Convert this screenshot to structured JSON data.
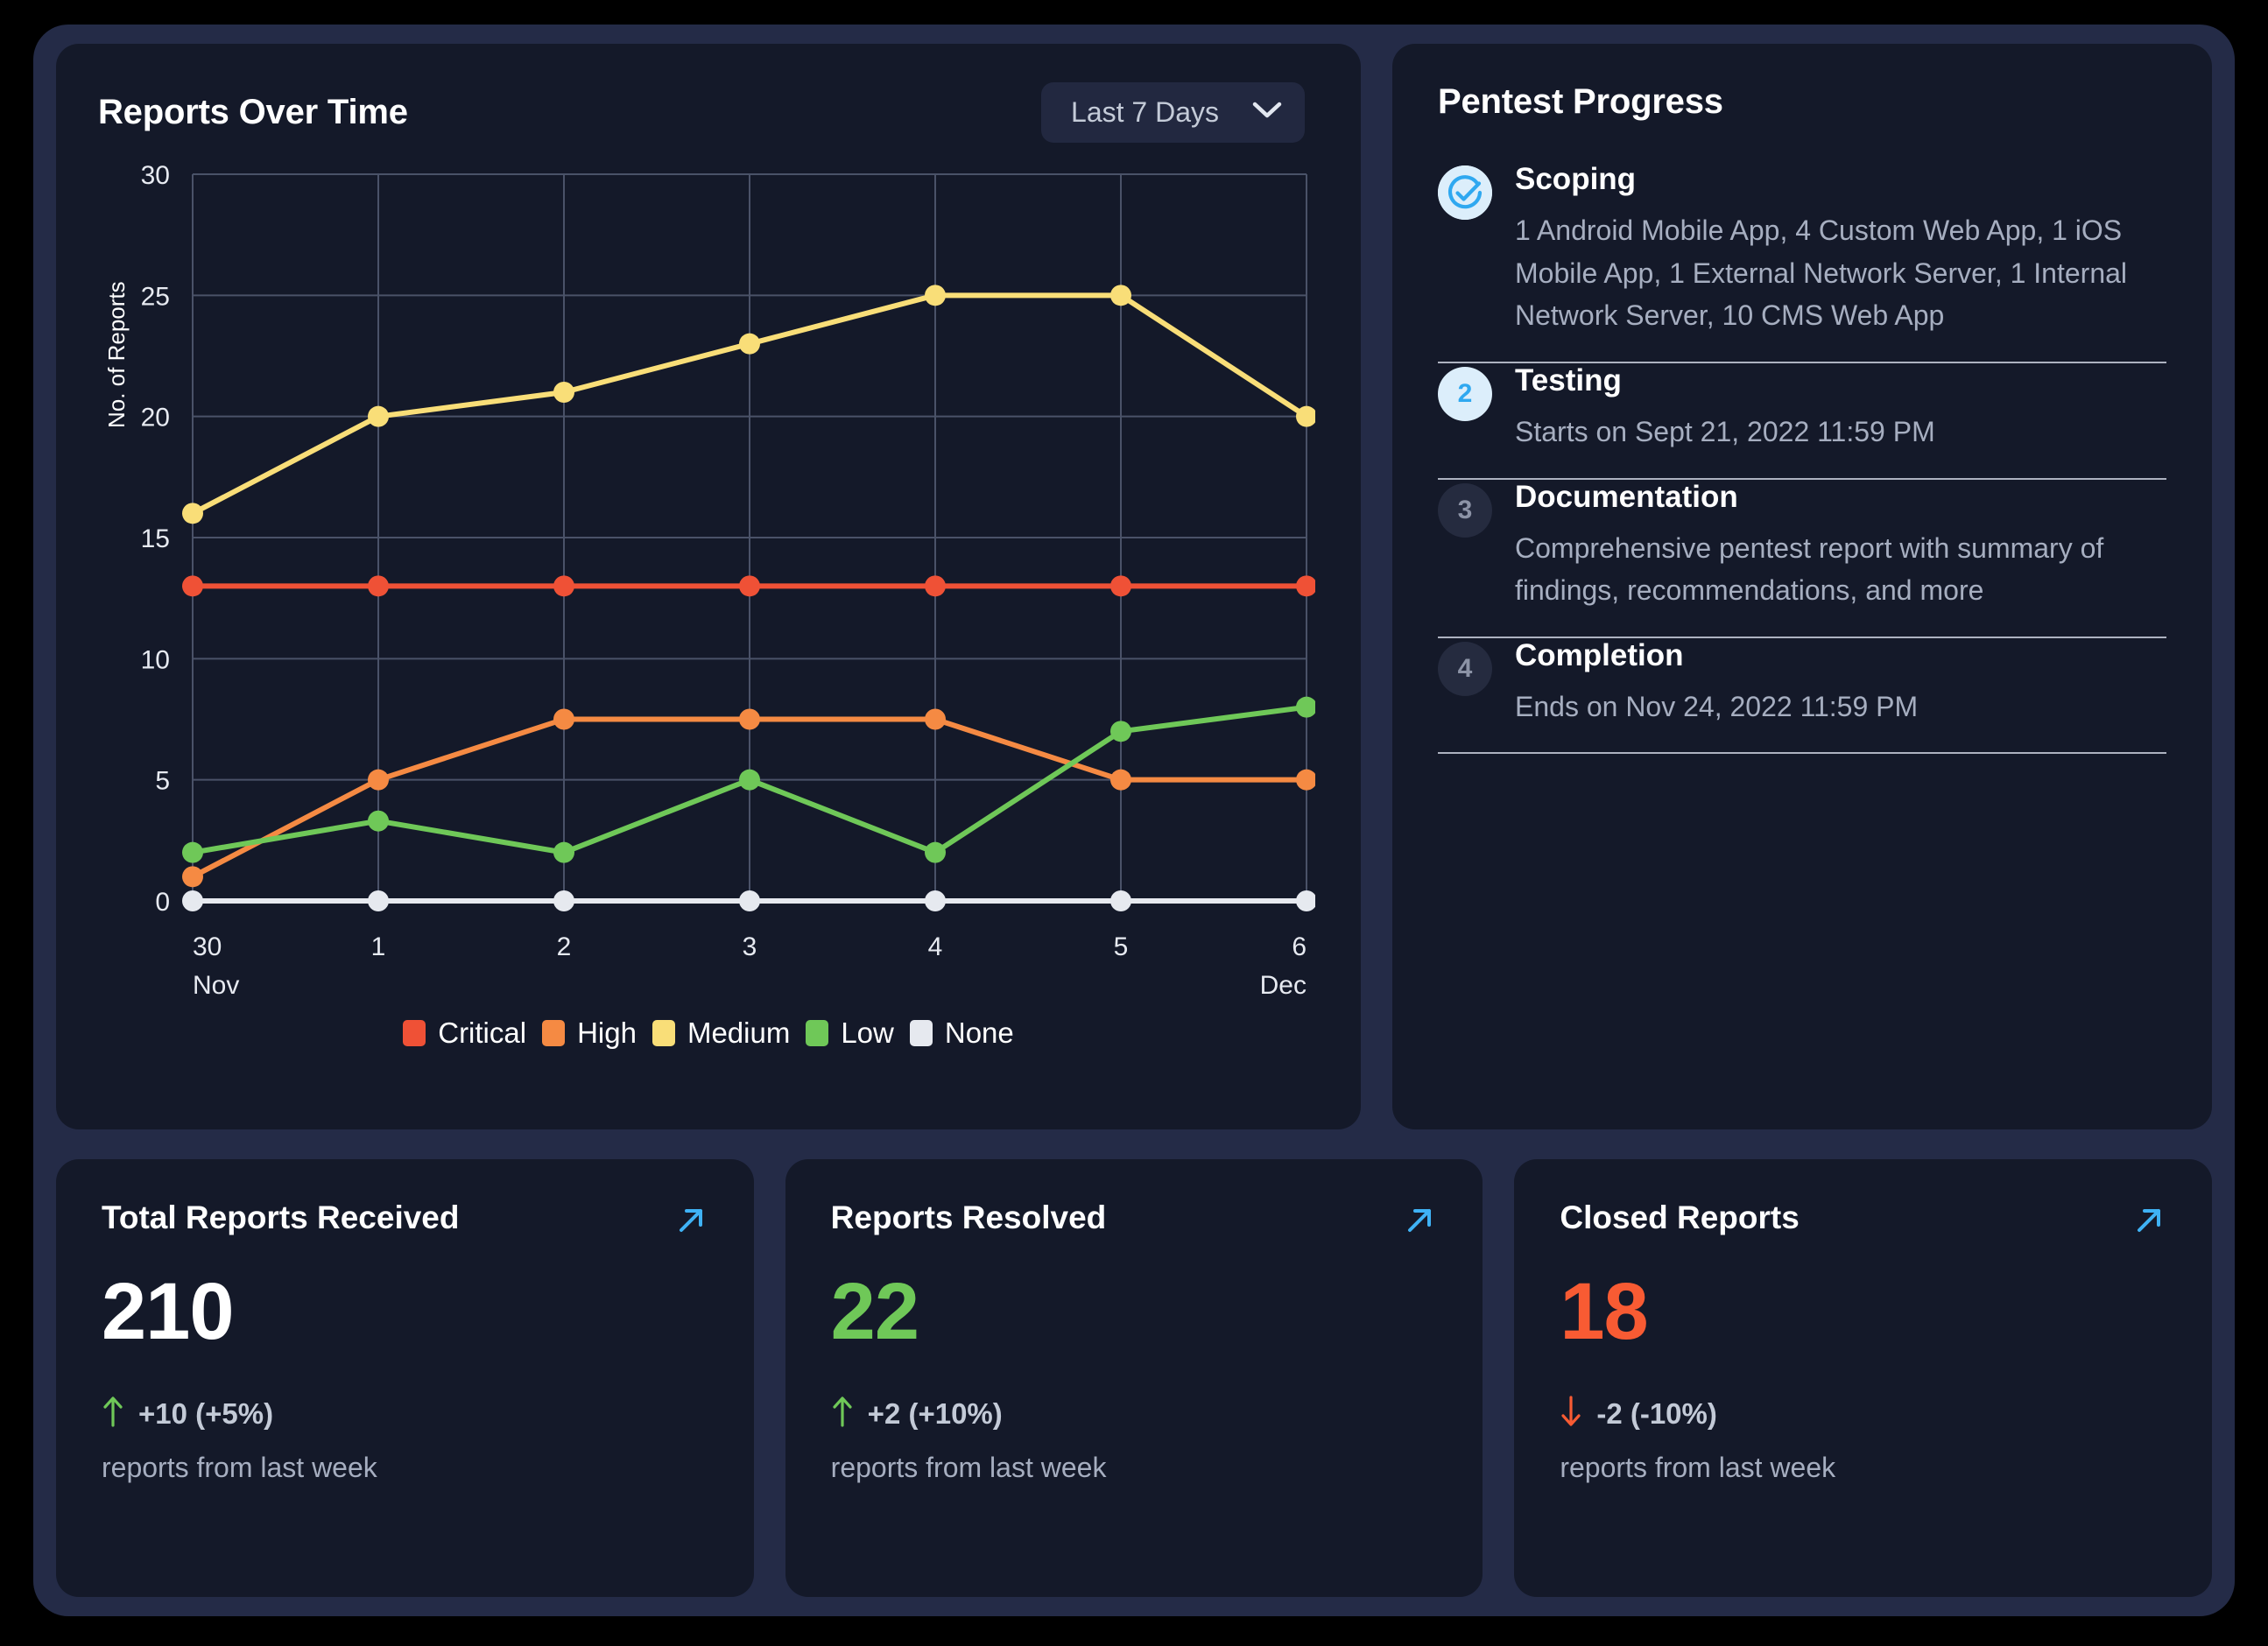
{
  "chart_panel": {
    "title": "Reports Over Time",
    "range_selector": {
      "value": "Last 7 Days",
      "chevron": "chevron-down-icon"
    }
  },
  "chart_data": {
    "type": "line",
    "title": "Reports Over Time",
    "xlabel": "",
    "ylabel": "No. of Reports",
    "categories": [
      "30\nNov",
      "1",
      "2",
      "3",
      "4",
      "5",
      "6\nDec"
    ],
    "x_tick_labels": [
      "30",
      "1",
      "2",
      "3",
      "4",
      "5",
      "6"
    ],
    "x_tick_sublabels": [
      "Nov",
      "",
      "",
      "",
      "",
      "",
      "Dec"
    ],
    "y_ticks": [
      0,
      5,
      10,
      15,
      20,
      25,
      30
    ],
    "ylim": [
      0,
      30
    ],
    "grid": true,
    "legend_position": "bottom",
    "series": [
      {
        "name": "Critical",
        "color": "#EF5136",
        "values": [
          13,
          13,
          13,
          13,
          13,
          13,
          13
        ]
      },
      {
        "name": "High",
        "color": "#F58A43",
        "values": [
          1,
          5,
          7.5,
          7.5,
          7.5,
          5,
          5
        ]
      },
      {
        "name": "Medium",
        "color": "#F9DE78",
        "values": [
          16,
          20,
          21,
          23,
          25,
          25,
          20
        ]
      },
      {
        "name": "Low",
        "color": "#6FC858",
        "values": [
          2,
          3.3,
          2,
          5,
          2,
          7,
          8
        ]
      },
      {
        "name": "None",
        "color": "#E6E9EF",
        "values": [
          0,
          0,
          0,
          0,
          0,
          0,
          0
        ]
      }
    ]
  },
  "progress_panel": {
    "title": "Pentest Progress",
    "steps": [
      {
        "badge": "check-circle-icon",
        "badge_state": "complete",
        "title": "Scoping",
        "desc": "1 Android Mobile App, 4 Custom Web App, 1 iOS Mobile App, 1 External Network Server, 1 Internal Network Server, 10 CMS Web App"
      },
      {
        "badge": "2",
        "badge_state": "active",
        "title": "Testing",
        "desc": "Starts on Sept 21, 2022 11:59 PM"
      },
      {
        "badge": "3",
        "badge_state": "idle",
        "title": "Documentation",
        "desc": "Comprehensive pentest report with summary of findings, recommendations, and more"
      },
      {
        "badge": "4",
        "badge_state": "idle",
        "title": "Completion",
        "desc": "Ends on Nov 24, 2022 11:59 PM"
      }
    ]
  },
  "stats": [
    {
      "title": "Total Reports Received",
      "value": "210",
      "value_color": "#FFFFFF",
      "delta_arrow": "arrow-up-icon",
      "delta_direction": "up",
      "delta_color": "#6FC858",
      "delta_text": "+10 (+5%)",
      "sub": "reports from last week",
      "link_icon": "arrow-up-right-icon"
    },
    {
      "title": "Reports Resolved",
      "value": "22",
      "value_color": "#6FC858",
      "delta_arrow": "arrow-up-icon",
      "delta_direction": "up",
      "delta_color": "#6FC858",
      "delta_text": "+2 (+10%)",
      "sub": "reports from last week",
      "link_icon": "arrow-up-right-icon"
    },
    {
      "title": "Closed Reports",
      "value": "18",
      "value_color": "#F85B33",
      "delta_arrow": "arrow-down-icon",
      "delta_direction": "down",
      "delta_color": "#F85B33",
      "delta_text": "-2 (-10%)",
      "sub": "reports from last week",
      "link_icon": "arrow-up-right-icon"
    }
  ],
  "theme": {
    "frame_bg": "#242B47",
    "card_bg": "#141929",
    "accent": "#3FB2F5",
    "grid": "#4A5268"
  }
}
